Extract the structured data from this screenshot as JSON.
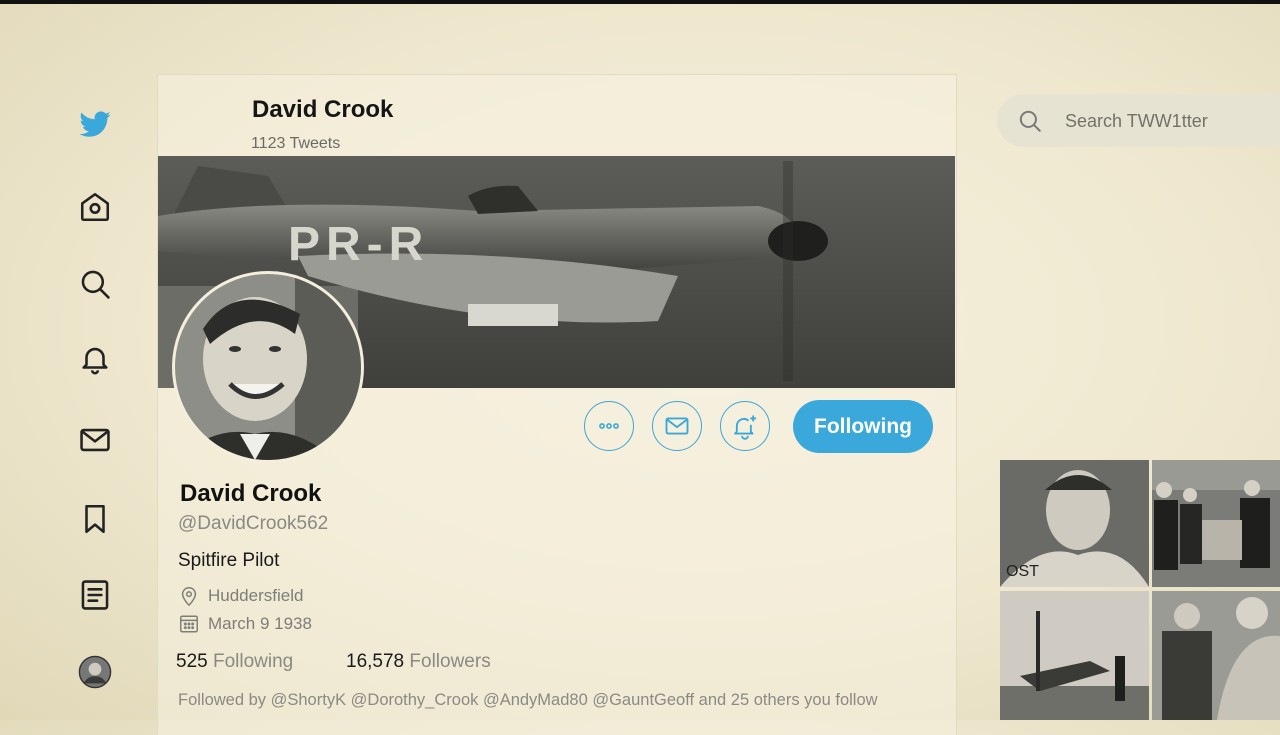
{
  "nav": {
    "items": [
      "twitter-logo",
      "home",
      "search",
      "notifications",
      "messages",
      "bookmarks",
      "lists",
      "profile"
    ]
  },
  "header": {
    "name": "David Crook",
    "tweet_count": "1123 Tweets"
  },
  "banner": {
    "aircraft_code": "PR-R"
  },
  "actions": {
    "follow_label": "Following"
  },
  "profile": {
    "name": "David Crook",
    "handle": "@DavidCrook562",
    "bio": "Spitfire Pilot",
    "location": "Huddersfield",
    "birthday": "March 9 1938",
    "following_count": "525",
    "following_label": "Following",
    "followers_count": "16,578",
    "followers_label": "Followers",
    "followed_by": "Followed by @ShortyK  @Dorothy_Crook  @AndyMad80  @GauntGeoff and 25 others you follow"
  },
  "search": {
    "placeholder": "Search TWW1tter"
  },
  "media": {
    "tile1_text": "OST"
  },
  "colors": {
    "accent": "#3aa8da",
    "background": "#f1ead2"
  }
}
